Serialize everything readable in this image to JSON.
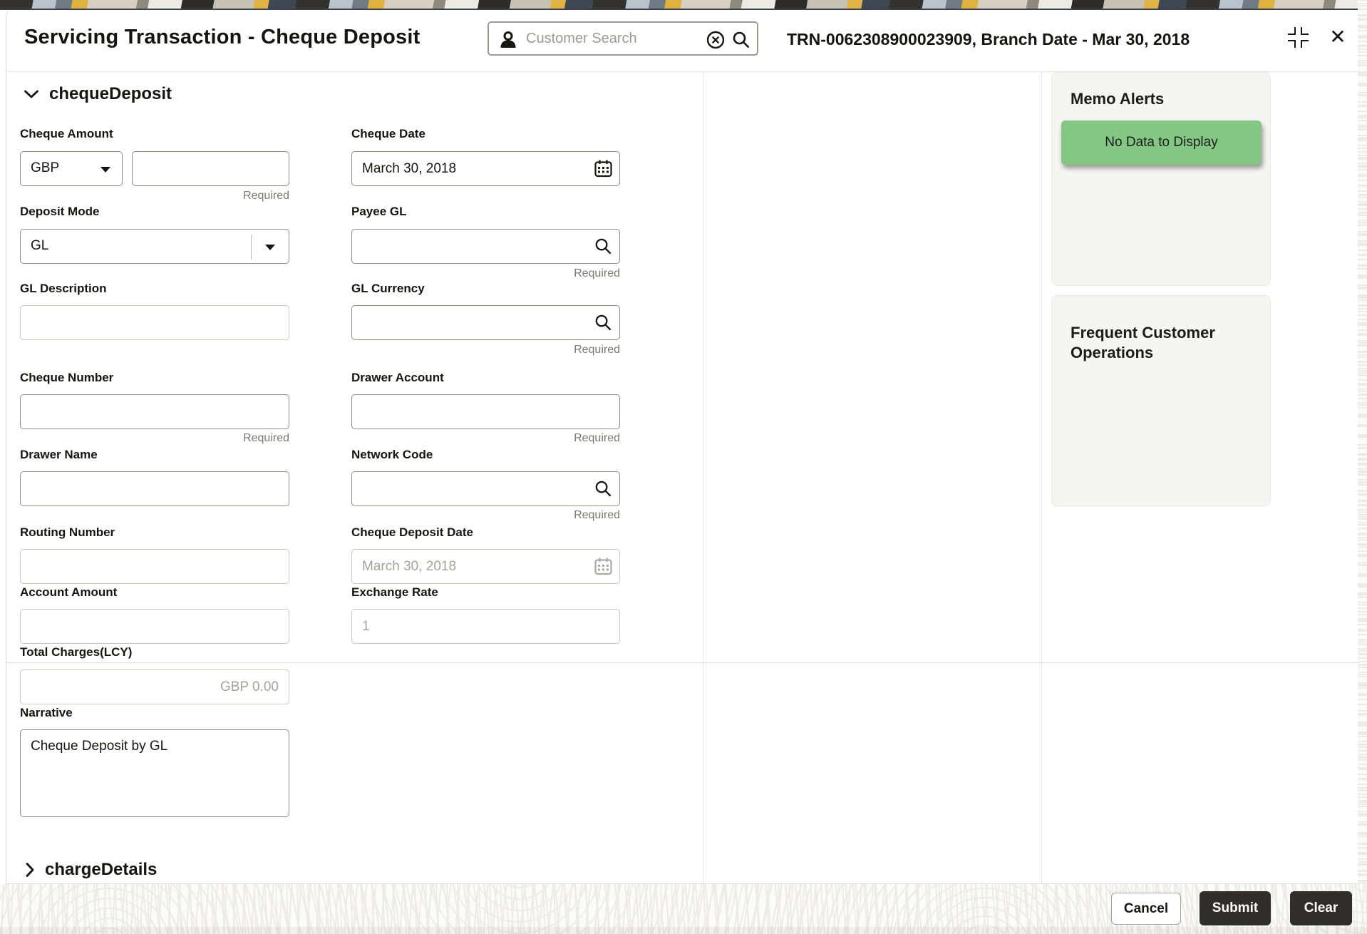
{
  "header": {
    "title": "Servicing Transaction - Cheque Deposit",
    "search_placeholder": "Customer Search",
    "transaction_info": "TRN-0062308900023909, Branch Date - Mar 30, 2018",
    "close_glyph": "✕"
  },
  "sections": {
    "cheque_deposit": {
      "label": "chequeDeposit",
      "state": "expanded"
    },
    "charge_details": {
      "label": "chargeDetails",
      "state": "collapsed"
    }
  },
  "fields": {
    "cheque_amount": {
      "label": "Cheque Amount",
      "currency": "GBP",
      "value": "",
      "required": "Required"
    },
    "cheque_date": {
      "label": "Cheque Date",
      "value": "March 30, 2018"
    },
    "deposit_mode": {
      "label": "Deposit Mode",
      "value": "GL"
    },
    "payee_gl": {
      "label": "Payee GL",
      "value": "",
      "required": "Required"
    },
    "gl_description": {
      "label": "GL Description",
      "value": ""
    },
    "gl_currency": {
      "label": "GL Currency",
      "value": "",
      "required": "Required"
    },
    "cheque_number": {
      "label": "Cheque Number",
      "value": "",
      "required": "Required"
    },
    "drawer_account": {
      "label": "Drawer Account",
      "value": "",
      "required": "Required"
    },
    "drawer_name": {
      "label": "Drawer Name",
      "value": ""
    },
    "network_code": {
      "label": "Network Code",
      "value": "",
      "required": "Required"
    },
    "routing_number": {
      "label": "Routing Number",
      "value": ""
    },
    "cheque_deposit_date": {
      "label": "Cheque Deposit Date",
      "value": "March 30, 2018",
      "disabled": true
    },
    "account_amount": {
      "label": "Account Amount",
      "value": ""
    },
    "exchange_rate": {
      "label": "Exchange Rate",
      "value": "1",
      "disabled": true
    },
    "total_charges": {
      "label": "Total Charges(LCY)",
      "value": "GBP 0.00",
      "disabled": true
    },
    "narrative": {
      "label": "Narrative",
      "value": "Cheque Deposit by GL"
    }
  },
  "sidebar": {
    "memo_alerts": {
      "title": "Memo Alerts",
      "empty_message": "No Data to Display"
    },
    "frequent_customer_operations": {
      "title": "Frequent Customer Operations"
    }
  },
  "footer": {
    "cancel_label": "Cancel",
    "submit_label": "Submit",
    "clear_label": "Clear"
  },
  "icons": {
    "customer": "person-silhouette",
    "clear_search": "circled-x",
    "search": "magnifier",
    "calendar": "calendar-grid",
    "section_expanded": "chevron-down",
    "section_collapsed": "chevron-right",
    "window_restore": "corner-brackets",
    "close": "✕"
  },
  "colors": {
    "status_green": "#84c784",
    "button_dark": "#312d2a",
    "required_gray": "#7b7970",
    "input_border": "#8e8d87",
    "card_bg": "#f5f5f4",
    "strip_gold": "#dfb13f",
    "strip_slate": "#3f4852"
  }
}
